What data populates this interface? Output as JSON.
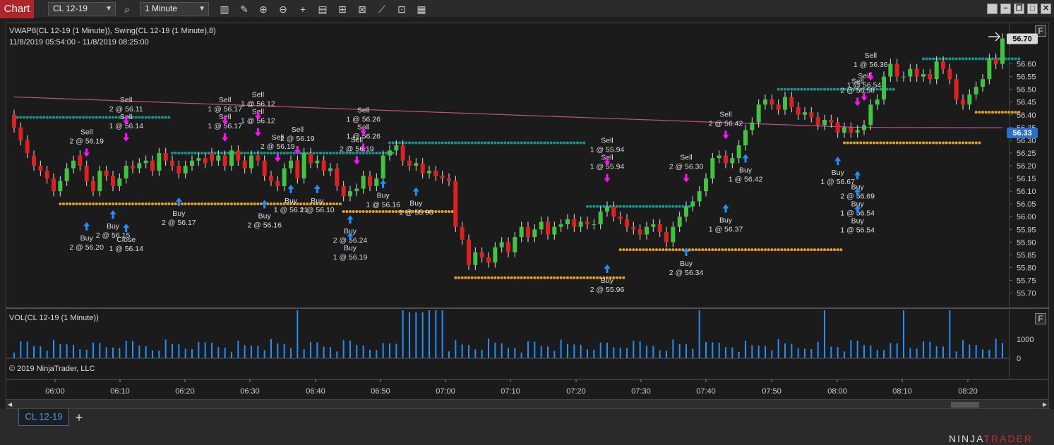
{
  "toolbar": {
    "chart_tab": "Chart",
    "instrument": "CL 12-19",
    "interval": "1 Minute",
    "icons": [
      "search-icon",
      "bar-type-icon",
      "draw-icon",
      "zoom-in-icon",
      "zoom-out-icon",
      "crosshair-icon",
      "data-box-icon",
      "strategies-icon",
      "indicators-icon",
      "chart-trader-icon",
      "templates-icon",
      "properties-icon"
    ]
  },
  "window": {
    "buttons": [
      "minimize",
      "restore",
      "maximize",
      "close"
    ]
  },
  "price_panel": {
    "legend": "VWAP8(CL 12-19 (1 Minute)), Swing(CL 12-19 (1 Minute),8)",
    "date_range": "11/8/2019 05:54:00 - 11/8/2019 08:25:00",
    "f_button": "F",
    "last_price": "56.70",
    "vwap_price": "56.33",
    "colors": {
      "up": "#3ec43e",
      "down": "#e02020",
      "vwap": "#c0508a",
      "swing_high": "#14968c",
      "swing_low": "#e0a020",
      "buy": "#1e90ff",
      "sell": "#ff10ff",
      "last_tag": "#d8d8d8",
      "vwap_tag": "#2a6fd0"
    }
  },
  "volume_panel": {
    "legend": "VOL(CL 12-19 (1 Minute))",
    "f_button": "F",
    "ticks": [
      "1000",
      "0"
    ],
    "copyright": "© 2019 NinjaTrader, LLC"
  },
  "time_axis": [
    "06:00",
    "06:10",
    "06:20",
    "06:30",
    "06:40",
    "06:50",
    "07:00",
    "07:10",
    "07:20",
    "07:30",
    "07:40",
    "07:50",
    "08:00",
    "08:10",
    "08:20"
  ],
  "bottom": {
    "instrument_tab": "CL 12-19",
    "add_tab": "+",
    "brand_ninja": "NINJA",
    "brand_trader": "TRADER"
  },
  "chart_data": {
    "type": "candlestick",
    "ylim": [
      55.66,
      56.74
    ],
    "yticks": [
      56.6,
      56.5,
      56.4,
      56.3,
      56.2,
      56.1,
      56.0,
      55.9,
      55.8,
      55.7
    ],
    "ytick_labels": [
      "56.60",
      "56.55",
      "56.50",
      "56.45",
      "56.40",
      "56.35",
      "56.30",
      "56.25",
      "56.20",
      "56.15",
      "56.10",
      "56.05",
      "56.00",
      "55.95",
      "55.90",
      "55.85",
      "55.80",
      "55.75",
      "55.70"
    ],
    "ytick_values": [
      56.6,
      56.55,
      56.5,
      56.45,
      56.4,
      56.35,
      56.3,
      56.25,
      56.2,
      56.15,
      56.1,
      56.05,
      56.0,
      55.95,
      55.9,
      55.85,
      55.8,
      55.75,
      55.7
    ],
    "bars_close": [
      56.35,
      56.3,
      56.25,
      56.2,
      56.18,
      56.15,
      56.1,
      56.14,
      56.19,
      56.22,
      56.2,
      56.14,
      56.1,
      56.18,
      56.16,
      56.12,
      56.15,
      56.2,
      56.19,
      56.21,
      56.22,
      56.18,
      56.25,
      56.22,
      56.2,
      56.17,
      56.2,
      56.22,
      56.23,
      56.21,
      56.22,
      56.24,
      56.2,
      56.26,
      56.22,
      56.19,
      56.24,
      56.22,
      56.16,
      56.14,
      56.12,
      56.19,
      56.22,
      56.15,
      56.25,
      56.21,
      56.22,
      56.18,
      56.19,
      56.12,
      56.08,
      56.1,
      56.11,
      56.16,
      56.12,
      56.15,
      56.24,
      56.26,
      56.28,
      56.22,
      56.2,
      56.21,
      56.17,
      56.18,
      56.16,
      56.15,
      56.14,
      55.96,
      55.91,
      55.81,
      55.86,
      55.84,
      55.82,
      55.88,
      55.9,
      55.86,
      55.92,
      55.96,
      55.92,
      55.95,
      55.98,
      55.93,
      55.96,
      55.97,
      55.99,
      55.96,
      55.98,
      55.97,
      55.97,
      56.02,
      56.04,
      56.0,
      55.99,
      55.96,
      55.95,
      55.93,
      55.96,
      55.97,
      55.94,
      55.9,
      55.96,
      56.0,
      56.04,
      56.06,
      56.1,
      56.15,
      56.23,
      56.24,
      56.21,
      56.23,
      56.28,
      56.34,
      56.37,
      56.44,
      56.46,
      56.44,
      56.42,
      56.47,
      56.43,
      56.4,
      56.41,
      56.39,
      56.36,
      56.38,
      56.37,
      56.33,
      56.35,
      56.33,
      56.34,
      56.36,
      56.44,
      56.46,
      56.55,
      56.6,
      56.55,
      56.55,
      56.58,
      56.55,
      56.56,
      56.54,
      56.61,
      56.58,
      56.54,
      56.46,
      56.44,
      56.48,
      56.51,
      56.54,
      56.62,
      56.6,
      56.7
    ],
    "bars_open": [
      56.4,
      56.35,
      56.3,
      56.24,
      56.2,
      56.18,
      56.15,
      56.1,
      56.14,
      56.19,
      56.24,
      56.2,
      56.14,
      56.1,
      56.18,
      56.16,
      56.12,
      56.15,
      56.2,
      56.19,
      56.21,
      56.22,
      56.18,
      56.25,
      56.22,
      56.2,
      56.17,
      56.2,
      56.22,
      56.23,
      56.25,
      56.22,
      56.24,
      56.2,
      56.26,
      56.22,
      56.19,
      56.24,
      56.22,
      56.16,
      56.14,
      56.12,
      56.19,
      56.22,
      56.15,
      56.25,
      56.21,
      56.22,
      56.18,
      56.19,
      56.12,
      56.08,
      56.1,
      56.11,
      56.16,
      56.12,
      56.15,
      56.24,
      56.26,
      56.28,
      56.22,
      56.2,
      56.21,
      56.17,
      56.18,
      56.16,
      56.15,
      56.14,
      55.96,
      55.91,
      55.81,
      55.86,
      55.84,
      55.82,
      55.88,
      55.9,
      55.86,
      55.92,
      55.96,
      55.92,
      55.95,
      55.98,
      55.93,
      55.96,
      55.97,
      55.99,
      55.96,
      55.98,
      55.97,
      55.97,
      56.02,
      56.04,
      56.0,
      55.99,
      55.96,
      55.95,
      55.93,
      55.96,
      55.97,
      55.94,
      55.9,
      55.96,
      56.0,
      56.04,
      56.06,
      56.1,
      56.15,
      56.23,
      56.24,
      56.21,
      56.23,
      56.28,
      56.34,
      56.37,
      56.44,
      56.46,
      56.44,
      56.42,
      56.47,
      56.43,
      56.4,
      56.41,
      56.39,
      56.36,
      56.38,
      56.37,
      56.33,
      56.35,
      56.33,
      56.34,
      56.36,
      56.44,
      56.46,
      56.55,
      56.6,
      56.55,
      56.55,
      56.58,
      56.55,
      56.56,
      56.54,
      56.61,
      56.58,
      56.54,
      56.46,
      56.44,
      56.48,
      56.51,
      56.54,
      56.62,
      56.6
    ],
    "swing_high_levels": [
      {
        "level": 56.39,
        "from": 0,
        "to": 23
      },
      {
        "level": 56.25,
        "from": 24,
        "to": 57
      },
      {
        "level": 56.29,
        "from": 57,
        "to": 86
      },
      {
        "level": 56.04,
        "from": 87,
        "to": 102
      },
      {
        "level": 56.5,
        "from": 116,
        "to": 133
      },
      {
        "level": 56.62,
        "from": 138,
        "to": 152
      }
    ],
    "swing_low_levels": [
      {
        "level": 56.05,
        "from": 7,
        "to": 49
      },
      {
        "level": 56.02,
        "from": 50,
        "to": 66
      },
      {
        "level": 55.76,
        "from": 67,
        "to": 92
      },
      {
        "level": 55.87,
        "from": 92,
        "to": 125
      },
      {
        "level": 56.29,
        "from": 126,
        "to": 146
      },
      {
        "level": 56.41,
        "from": 146,
        "to": 152
      }
    ],
    "trade_labels": [
      {
        "side": "Sell",
        "text": "2 @ 56.19",
        "bar": 11
      },
      {
        "side": "Sell",
        "text": "1 @ 56.14",
        "bar": 17
      },
      {
        "side": "Sell",
        "text": "2 @ 56.11",
        "bar": 17
      },
      {
        "side": "Buy",
        "text": "2 @ 56.20",
        "bar": 11
      },
      {
        "side": "Buy",
        "text": "2 @ 56.15",
        "bar": 15
      },
      {
        "side": "Close",
        "text": "1 @ 56.14",
        "bar": 17
      },
      {
        "side": "Buy",
        "text": "2 @ 56.17",
        "bar": 25
      },
      {
        "side": "Sell",
        "text": "1 @ 56.17",
        "bar": 32
      },
      {
        "side": "Sell",
        "text": "1 @ 56.17",
        "bar": 32
      },
      {
        "side": "Sell",
        "text": "1 @ 56.12",
        "bar": 37
      },
      {
        "side": "Sell",
        "text": "1 @ 56.12",
        "bar": 37
      },
      {
        "side": "Sell",
        "text": "2 @ 56.19",
        "bar": 40
      },
      {
        "side": "Sell",
        "text": "2 @ 56.19",
        "bar": 43
      },
      {
        "side": "Buy",
        "text": "2 @ 56.16",
        "bar": 38
      },
      {
        "side": "Buy",
        "text": "1 @ 56.21",
        "bar": 42
      },
      {
        "side": "Buy",
        "text": "1 @ 56.10",
        "bar": 46
      },
      {
        "side": "Sell",
        "text": "1 @ 56.26",
        "bar": 53
      },
      {
        "side": "Sell",
        "text": "2 @ 56.19",
        "bar": 52
      },
      {
        "side": "Sell",
        "text": "1 @ 56.26",
        "bar": 53
      },
      {
        "side": "Buy",
        "text": "2 @ 56.24",
        "bar": 51
      },
      {
        "side": "Buy",
        "text": "1 @ 56.19",
        "bar": 51
      },
      {
        "side": "Buy",
        "text": "1 @ 56.16",
        "bar": 56
      },
      {
        "side": "Buy",
        "text": "1 @ 55.96",
        "bar": 61
      },
      {
        "side": "Sell",
        "text": "1 @ 55.94",
        "bar": 90
      },
      {
        "side": "Sell",
        "text": "1 @ 55.94",
        "bar": 90
      },
      {
        "side": "Buy",
        "text": "2 @ 55.96",
        "bar": 90
      },
      {
        "side": "Sell",
        "text": "2 @ 56.30",
        "bar": 102
      },
      {
        "side": "Buy",
        "text": "2 @ 56.34",
        "bar": 102
      },
      {
        "side": "Sell",
        "text": "2 @ 56.42",
        "bar": 108
      },
      {
        "side": "Buy",
        "text": "1 @ 56.37",
        "bar": 108
      },
      {
        "side": "Buy",
        "text": "1 @ 56.42",
        "bar": 111
      },
      {
        "side": "Sell",
        "text": "2 @ 56.58",
        "bar": 128
      },
      {
        "side": "Sell",
        "text": "1 @ 56.54",
        "bar": 129
      },
      {
        "side": "Sell",
        "text": "1 @ 56.36",
        "bar": 130
      },
      {
        "side": "Buy",
        "text": "1 @ 56.67",
        "bar": 125
      },
      {
        "side": "Buy",
        "text": "2 @ 56.69",
        "bar": 128
      },
      {
        "side": "Buy",
        "text": "1 @ 56.54",
        "bar": 128
      },
      {
        "side": "Buy",
        "text": "1 @ 56.54",
        "bar": 128
      }
    ]
  }
}
